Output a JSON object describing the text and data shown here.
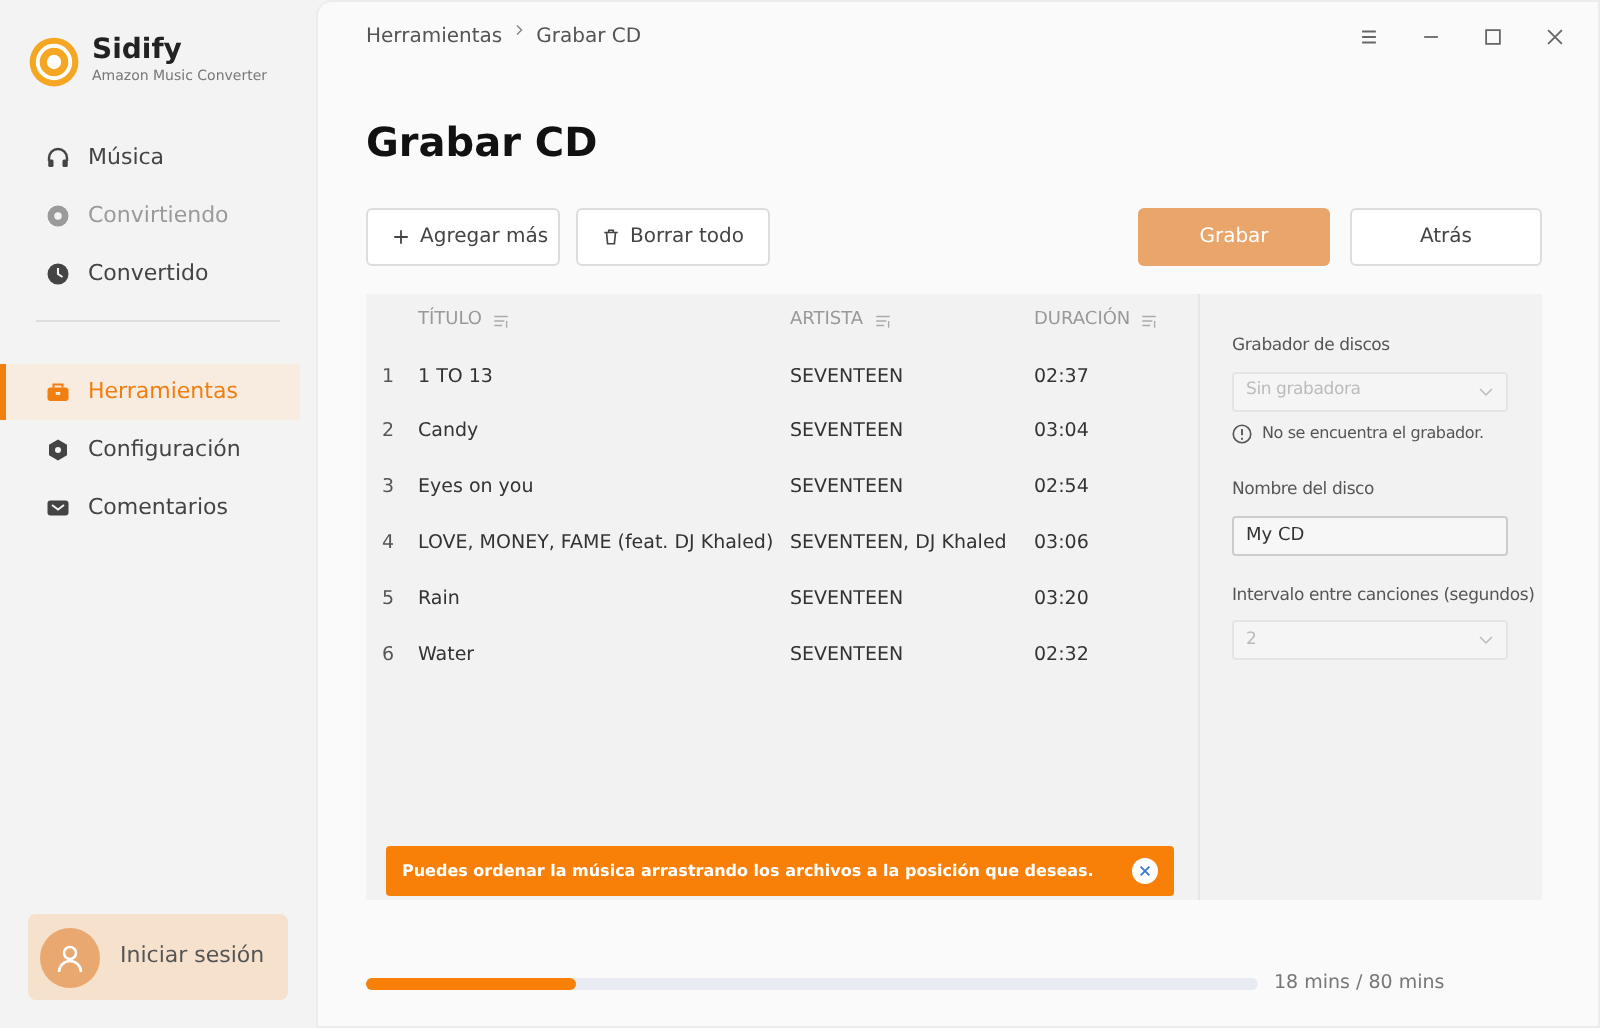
{
  "app": {
    "name": "Sidify",
    "subtitle": "Amazon Music Converter"
  },
  "sidebar": {
    "groups": [
      [
        {
          "label": "Música",
          "selected": false,
          "disabled": false
        },
        {
          "label": "Convirtiendo",
          "selected": false,
          "disabled": true
        },
        {
          "label": "Convertido",
          "selected": false,
          "disabled": false
        }
      ],
      [
        {
          "label": "Herramientas",
          "selected": true,
          "disabled": false
        },
        {
          "label": "Configuración",
          "selected": false,
          "disabled": false
        },
        {
          "label": "Comentarios",
          "selected": false,
          "disabled": false
        }
      ]
    ],
    "login": "Iniciar sesión"
  },
  "breadcrumb": [
    "Herramientas",
    "Grabar CD"
  ],
  "title": "Grabar CD",
  "toolbar": {
    "add": "Agregar más",
    "clear": "Borrar todo",
    "burn": {
      "label": "Grabar",
      "disabled": true
    },
    "back": "Atrás"
  },
  "table": {
    "columns": [
      "TÍTULO",
      "ARTISTA",
      "DURACIÓN"
    ],
    "rows": [
      {
        "index": "1",
        "title": "1 TO 13",
        "artist": "SEVENTEEN",
        "duration": "02:37"
      },
      {
        "index": "2",
        "title": "Candy",
        "artist": "SEVENTEEN",
        "duration": "03:04"
      },
      {
        "index": "3",
        "title": "Eyes on you",
        "artist": "SEVENTEEN",
        "duration": "02:54"
      },
      {
        "index": "4",
        "title": "LOVE, MONEY, FAME (feat. DJ Khaled)",
        "artist": "SEVENTEEN, DJ Khaled",
        "duration": "03:06"
      },
      {
        "index": "5",
        "title": "Rain",
        "artist": "SEVENTEEN",
        "duration": "03:20"
      },
      {
        "index": "6",
        "title": "Water",
        "artist": "SEVENTEEN",
        "duration": "02:32"
      }
    ]
  },
  "tip": "Puedes ordenar la música arrastrando los archivos a la posición que deseas.",
  "settings": {
    "burner_label": "Grabador de discos",
    "burner_value": "Sin grabadora",
    "burner_disabled": true,
    "burner_warning": "No se encuentra el grabador.",
    "disc_label": "Nombre del disco",
    "disc_value": "My CD",
    "interval_label": "Intervalo entre canciones (segundos)",
    "interval_value": "2",
    "interval_disabled": true
  },
  "capacity": {
    "level": 0.235,
    "reading": "18 mins / 80 mins"
  }
}
